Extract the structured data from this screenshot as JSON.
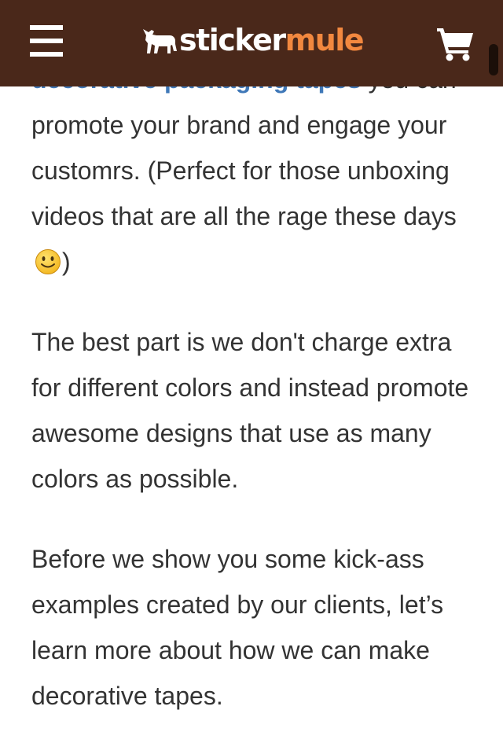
{
  "header": {
    "logo_name": "stickermule",
    "logo_part1": "sticker",
    "logo_part2": "mule",
    "menu_icon": "hamburger-menu-icon",
    "cart_icon": "shopping-cart-icon",
    "colors": {
      "background": "#4a281a",
      "logo_accent": "#f2883f",
      "link": "#3f78b8",
      "text": "#333333"
    }
  },
  "article": {
    "p1": {
      "link_text": "decorative packaging tapes",
      "text": " you can promote your brand and engage your customrs. (Perfect for those unboxing videos that are all the rage these days ",
      "emoji": "slightly-smiling-face-icon",
      "after": ")"
    },
    "p2": "The best part is we don't charge extra for different colors and instead promote awesome designs that use as many colors as possible.",
    "p3": "Before we show you some kick-ass examples created by our clients, let’s learn more about how we can make decorative tapes."
  }
}
